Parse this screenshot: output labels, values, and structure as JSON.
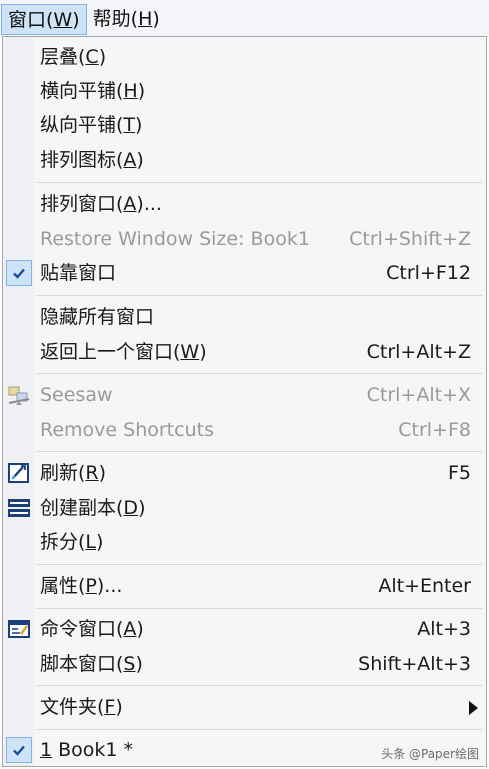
{
  "menubar": {
    "window_menu": "窗口(",
    "window_key": "W",
    "help_menu": "帮助(",
    "help_key": "H",
    "close": ")"
  },
  "menu": {
    "cascade": {
      "label": "层叠(",
      "key": "C",
      "suffix": ")"
    },
    "tile_horizontal": {
      "label": "横向平铺(",
      "key": "H",
      "suffix": ")"
    },
    "tile_vertical": {
      "label": "纵向平铺(",
      "key": "T",
      "suffix": ")"
    },
    "arrange_icons": {
      "label": "排列图标(",
      "key": "A",
      "suffix": ")"
    },
    "arrange_windows": {
      "label": "排列窗口(",
      "key": "A",
      "suffix": ")..."
    },
    "restore_window_size": {
      "label": "Restore Window Size: Book1",
      "shortcut": "Ctrl+Shift+Z"
    },
    "dock_window": {
      "label": "贴靠窗口",
      "shortcut": "Ctrl+F12",
      "checked": true
    },
    "hide_all_windows": {
      "label": "隐藏所有窗口"
    },
    "return_previous_window": {
      "label": "返回上一个窗口(",
      "key": "W",
      "suffix": ")",
      "shortcut": "Ctrl+Alt+Z"
    },
    "seesaw": {
      "label": "Seesaw",
      "shortcut": "Ctrl+Alt+X",
      "icon": "seesaw-icon"
    },
    "remove_shortcuts": {
      "label": "Remove Shortcuts",
      "shortcut": "Ctrl+F8"
    },
    "refresh": {
      "label": "刷新(",
      "key": "R",
      "suffix": ")",
      "shortcut": "F5",
      "icon": "refresh-icon"
    },
    "create_copy": {
      "label": "创建副本(",
      "key": "D",
      "suffix": ")",
      "icon": "duplicate-icon"
    },
    "split": {
      "label": "拆分(",
      "key": "L",
      "suffix": ")"
    },
    "properties": {
      "label": "属性(",
      "key": "P",
      "suffix": ")...",
      "shortcut": "Alt+Enter"
    },
    "command_window": {
      "label": "命令窗口(",
      "key": "A",
      "suffix": ")",
      "shortcut": "Alt+3",
      "icon": "command-window-icon"
    },
    "script_window": {
      "label": "脚本窗口(",
      "key": "S",
      "suffix": ")",
      "shortcut": "Shift+Alt+3"
    },
    "folder": {
      "label": "文件夹(",
      "key": "F",
      "suffix": ")",
      "icon": "chevron-right-icon"
    },
    "book1": {
      "key": "1",
      "label": " Book1 *",
      "checked": true
    }
  },
  "watermark": {
    "text": "头条 @Paper绘图"
  },
  "colors": {
    "highlight_bg": "#cfe3f7",
    "highlight_border": "#7eb4ea",
    "disabled_text": "#9a9a9a",
    "check_blue": "#1b4f9c"
  }
}
